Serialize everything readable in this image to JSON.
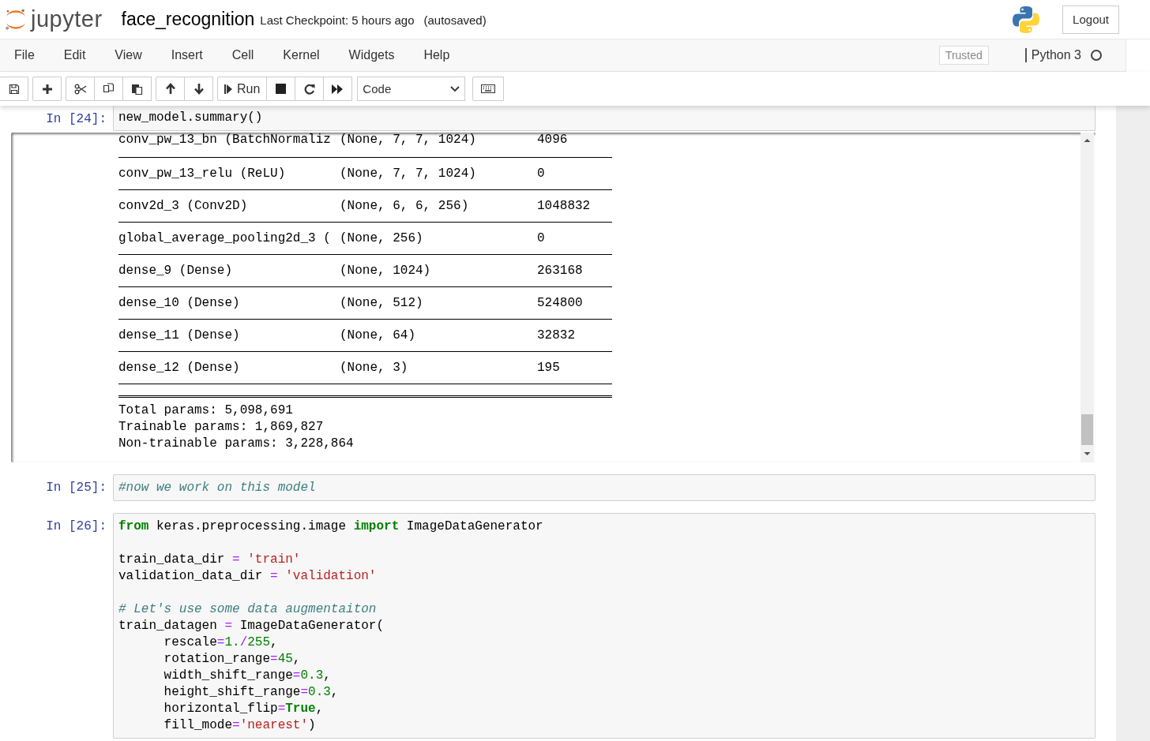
{
  "header": {
    "logo_text": "jupyter",
    "notebook_name": "face_recognition",
    "checkpoint": "Last Checkpoint: 5 hours ago",
    "autosave": "(autosaved)",
    "logout": "Logout"
  },
  "menu": [
    "File",
    "Edit",
    "View",
    "Insert",
    "Cell",
    "Kernel",
    "Widgets",
    "Help"
  ],
  "status": {
    "trusted": "Trusted",
    "kernel": "Python 3",
    "kernel_busy": false
  },
  "toolbar": {
    "run_label": "Run",
    "cell_type": "Code"
  },
  "cells": [
    {
      "prompt": "In [24]:",
      "blocks": [
        [
          [
            {
              "kind": "plain",
              "t": "new_model.summary()"
            }
          ]
        ]
      ],
      "output": {
        "rows": [
          {
            "name": "conv_pw_13_bn (BatchNormaliz",
            "shape": "(None, 7, 7, 1024)",
            "params": "4096"
          },
          {
            "name": "conv_pw_13_relu (ReLU)",
            "shape": "(None, 7, 7, 1024)",
            "params": "0"
          },
          {
            "name": "conv2d_3 (Conv2D)",
            "shape": "(None, 6, 6, 256)",
            "params": "1048832"
          },
          {
            "name": "global_average_pooling2d_3 (",
            "shape": "(None, 256)",
            "params": "0"
          },
          {
            "name": "dense_9 (Dense)",
            "shape": "(None, 1024)",
            "params": "263168"
          },
          {
            "name": "dense_10 (Dense)",
            "shape": "(None, 512)",
            "params": "524800"
          },
          {
            "name": "dense_11 (Dense)",
            "shape": "(None, 64)",
            "params": "32832"
          },
          {
            "name": "dense_12 (Dense)",
            "shape": "(None, 3)",
            "params": "195"
          }
        ],
        "totals": [
          "Total params: 5,098,691",
          "Trainable params: 1,869,827",
          "Non-trainable params: 3,228,864"
        ]
      }
    },
    {
      "prompt": "In [25]:",
      "blocks": [
        [
          [
            {
              "kind": "comment",
              "t": "#now we work on this model"
            }
          ]
        ]
      ]
    },
    {
      "prompt": "In [26]:",
      "blocks": [
        [
          [
            {
              "kind": "kw",
              "t": "from"
            },
            {
              "kind": "plain",
              "t": " keras.preprocessing.image "
            },
            {
              "kind": "kw",
              "t": "import"
            },
            {
              "kind": "plain",
              "t": " ImageDataGenerator"
            }
          ]
        ],
        [
          [
            {
              "kind": "plain",
              "t": "train_data_dir"
            },
            {
              "kind": "op",
              "t": " = "
            },
            {
              "kind": "str",
              "t": "'train'"
            }
          ],
          [
            {
              "kind": "plain",
              "t": "validation_data_dir"
            },
            {
              "kind": "op",
              "t": " = "
            },
            {
              "kind": "str",
              "t": "'validation'"
            }
          ]
        ],
        [
          [
            {
              "kind": "comment",
              "t": "# Let's use some data augmentaiton"
            }
          ],
          [
            {
              "kind": "plain",
              "t": "train_datagen"
            },
            {
              "kind": "op",
              "t": " = "
            },
            {
              "kind": "plain",
              "t": "ImageDataGenerator("
            }
          ],
          [
            {
              "kind": "plain",
              "t": "      rescale"
            },
            {
              "kind": "op",
              "t": "="
            },
            {
              "kind": "num",
              "t": "1."
            },
            {
              "kind": "op",
              "t": "/"
            },
            {
              "kind": "num",
              "t": "255"
            },
            {
              "kind": "plain",
              "t": ","
            }
          ],
          [
            {
              "kind": "plain",
              "t": "      rotation_range"
            },
            {
              "kind": "op",
              "t": "="
            },
            {
              "kind": "num",
              "t": "45"
            },
            {
              "kind": "plain",
              "t": ","
            }
          ],
          [
            {
              "kind": "plain",
              "t": "      width_shift_range"
            },
            {
              "kind": "op",
              "t": "="
            },
            {
              "kind": "num",
              "t": "0.3"
            },
            {
              "kind": "plain",
              "t": ","
            }
          ],
          [
            {
              "kind": "plain",
              "t": "      height_shift_range"
            },
            {
              "kind": "op",
              "t": "="
            },
            {
              "kind": "num",
              "t": "0.3"
            },
            {
              "kind": "plain",
              "t": ","
            }
          ],
          [
            {
              "kind": "plain",
              "t": "      horizontal_flip"
            },
            {
              "kind": "op",
              "t": "="
            },
            {
              "kind": "kw",
              "t": "True"
            },
            {
              "kind": "plain",
              "t": ","
            }
          ],
          [
            {
              "kind": "plain",
              "t": "      fill_mode"
            },
            {
              "kind": "op",
              "t": "="
            },
            {
              "kind": "str",
              "t": "'nearest'"
            },
            {
              "kind": "plain",
              "t": ")"
            }
          ]
        ]
      ]
    }
  ]
}
